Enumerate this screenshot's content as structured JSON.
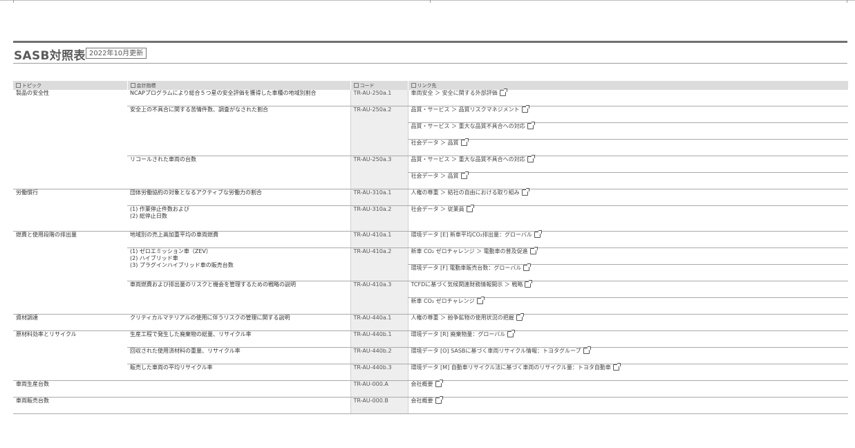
{
  "title": "SASB対照表",
  "updated_badge": "2022年10月更新",
  "headers": {
    "topic": "トピック",
    "metric": "会計指標",
    "code": "コード",
    "link": "リンク先"
  },
  "topics": {
    "t1": "製品の安全性",
    "t2": "労働慣行",
    "t3": "燃費と使用段階の排出量",
    "t4": "資材調達",
    "t5": "原材料効率とリサイクル",
    "t6": "車両生産台数",
    "t7": "車両販売台数"
  },
  "metrics": {
    "m1": "NCAPプログラムにより総合５つ星の安全評価を獲得した車種の地域別割合",
    "m2": "安全上の不具合に関する苦情件数、調査がなされた割合",
    "m3": "リコールされた車両の台数",
    "m4": "団体労働協約の対象となるアクティブな労働力の割合",
    "m5a": "(1) 作業停止件数および",
    "m5b": "(2) 総停止日数",
    "m6": "地域別の売上高加重平均の車両燃費",
    "m7a": "(1) ゼロエミッション車（ZEV）",
    "m7b": "(2) ハイブリッド車",
    "m7c": "(3) プラグインハイブリッド車の販売台数",
    "m8": "車両燃費および排出量のリスクと機会を管理するための戦略の説明",
    "m9": "クリティカルマテリアルの使用に伴うリスクの管理に関する説明",
    "m10": "生産工程で発生した廃棄物の総量、リサイクル率",
    "m11": "回収された使用済材料の重量、リサイクル率",
    "m12": "販売した車両の平均リサイクル率"
  },
  "codes": {
    "c1": "TR-AU-250a.1",
    "c2": "TR-AU-250a.2",
    "c3": "TR-AU-250a.3",
    "c4": "TR-AU-310a.1",
    "c5": "TR-AU-310a.2",
    "c6": "TR-AU-410a.1",
    "c7": "TR-AU-410a.2",
    "c8": "TR-AU-410a.3",
    "c9": "TR-AU-440a.1",
    "c10": "TR-AU-440b.1",
    "c11": "TR-AU-440b.2",
    "c12": "TR-AU-440b.3",
    "c13": "TR-AU-000.A",
    "c14": "TR-AU-000.B"
  },
  "links": {
    "l1": "車両安全 ＞ 安全に関する外部評価",
    "l2": "品質・サービス ＞ 品質リスクマネジメント",
    "l3": "品質・サービス ＞ 重大な品質不具合への対応",
    "l4": "社会データ ＞ 品質",
    "l5": "品質・サービス ＞ 重大な品質不具合への対応",
    "l6": "社会データ ＞ 品質",
    "l7": "人権の尊重 ＞ 結社の自由における取り組み",
    "l8": "社会データ ＞ 従業員",
    "l9": "環境データ [E] 新車平均CO₂排出量：グローバル",
    "l10": "新車 CO₂ ゼロチャレンジ ＞ 電動車の普及促進",
    "l11": "環境データ [F] 電動車販売台数：グローバル",
    "l12": "TCFDに基づく気候関連財務情報開示 ＞ 戦略",
    "l13": "新車 CO₂ ゼロチャレンジ",
    "l14": "人権の尊重 ＞ 紛争鉱物の使用状況の把握",
    "l15": "環境データ [R] 廃棄物量：グローバル",
    "l16": "環境データ [O] SASBに基づく車両リサイクル情報：トヨタグループ",
    "l17": "環境データ [M] 自動車リサイクル法に基づく車両のリサイクル量：トヨタ自動車",
    "l18": "会社概要",
    "l19": "会社概要"
  }
}
